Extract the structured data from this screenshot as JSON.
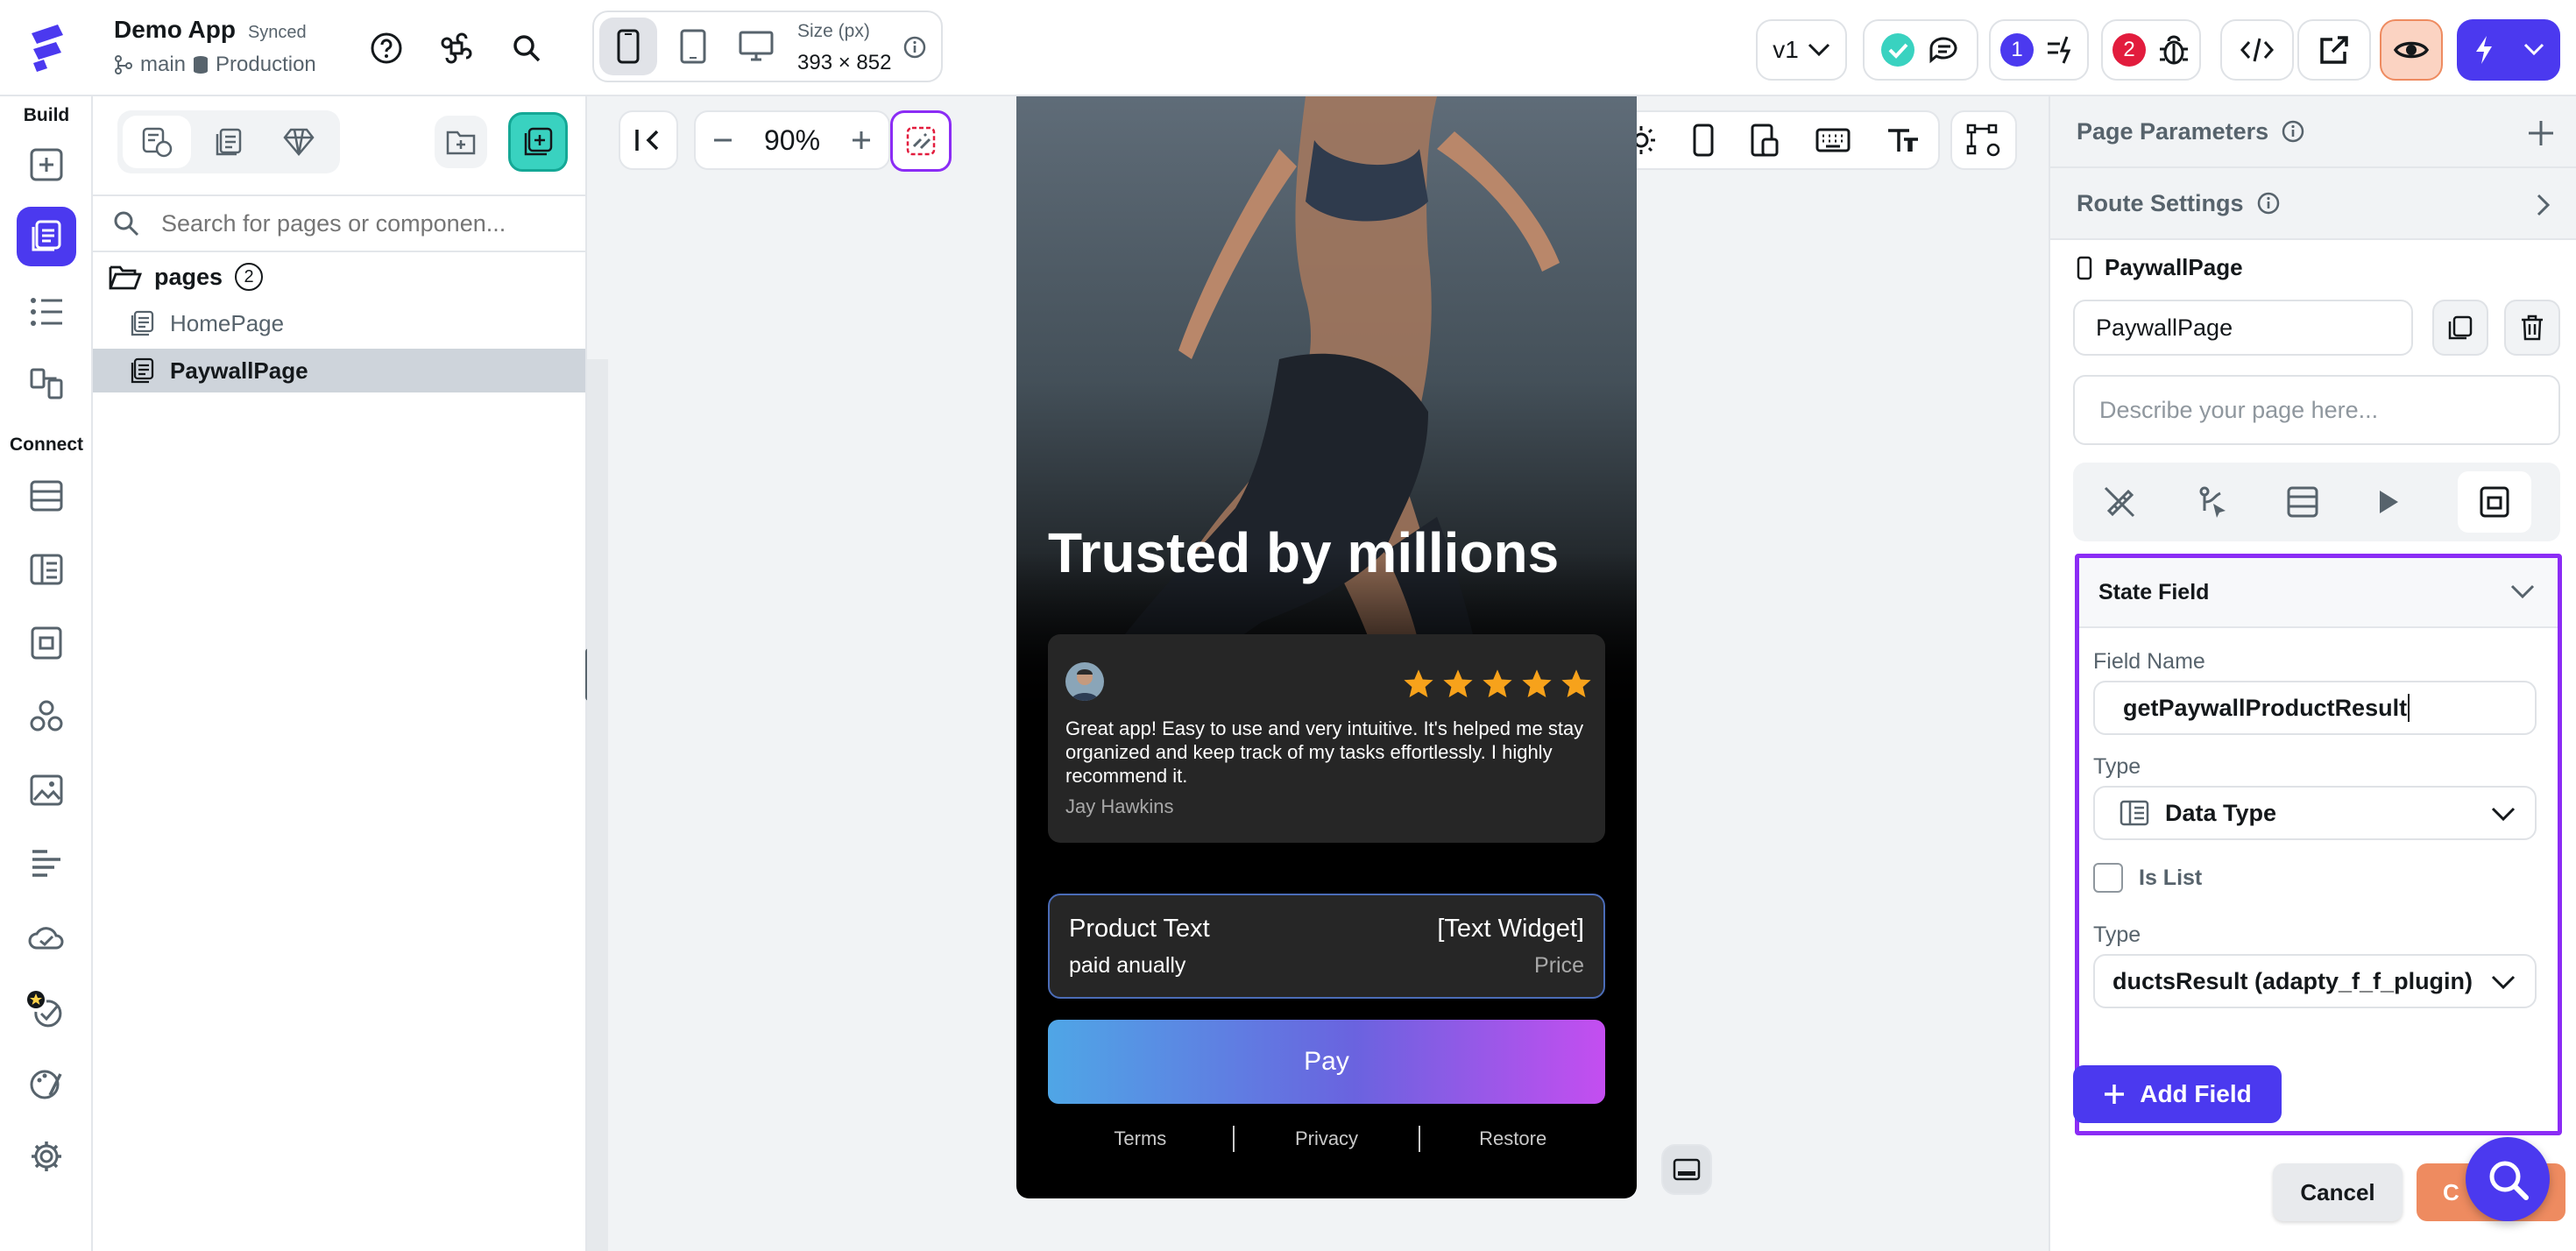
{
  "app": {
    "name": "Demo App",
    "sync_status": "Synced",
    "branch": "main",
    "environment": "Production"
  },
  "device": {
    "size_label": "Size (px)",
    "size_value": "393 × 852"
  },
  "toolbar": {
    "version": "v1",
    "notifications_count": "1",
    "bugs_count": "2"
  },
  "rail": {
    "build_label": "Build",
    "connect_label": "Connect"
  },
  "pages_panel": {
    "search_placeholder": "Search for pages or componen...",
    "folder_label": "pages",
    "folder_count": "2",
    "items": [
      "HomePage",
      "PaywallPage"
    ]
  },
  "canvas": {
    "zoom": "90%"
  },
  "phone": {
    "headline": "Trusted by millions",
    "review_text": "Great app! Easy to use and very intuitive. It's helped me stay organized and keep track of my tasks effortlessly.  I highly recommend it.",
    "reviewer": "Jay Hawkins",
    "rating": 5,
    "product_title": "Product Text",
    "product_subtitle": "paid anually",
    "product_widget": "[Text Widget]",
    "product_price": "Price",
    "pay_label": "Pay",
    "footer_links": [
      "Terms",
      "Privacy",
      "Restore"
    ]
  },
  "props": {
    "page_parameters": "Page Parameters",
    "route_settings": "Route Settings",
    "page_name_heading": "PaywallPage",
    "page_name_value": "PaywallPage",
    "description_placeholder": "Describe your page here...",
    "state_field_title": "State Field",
    "field_name_label": "Field Name",
    "field_name_value": "getPaywallProductResult",
    "type_label": "Type",
    "type_value": "Data Type",
    "is_list_label": "Is List",
    "type2_label": "Type",
    "type2_value": "ductsResult (adapty_f_f_plugin)",
    "add_field_label": "Add Field",
    "cancel_label": "Cancel",
    "confirm_label": "C"
  },
  "colors": {
    "accent": "#4b39ef",
    "accent_light": "#e8e6ff",
    "teal": "#39d2c0",
    "orange": "#ee8b60",
    "highlight": "#8b2cf5",
    "pay_gradient_start": "#4fa6e6",
    "pay_gradient_end": "#c44ef0"
  }
}
